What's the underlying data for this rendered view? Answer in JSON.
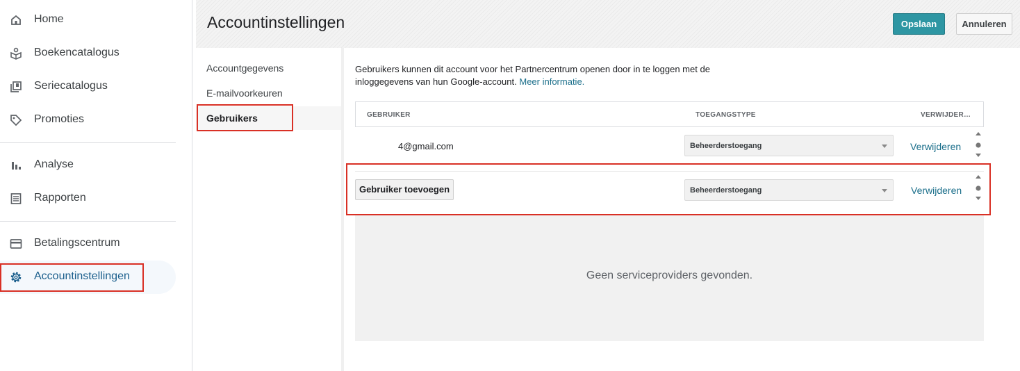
{
  "nav": {
    "items": [
      {
        "label": "Home",
        "icon": "home-icon"
      },
      {
        "label": "Boekencatalogus",
        "icon": "book-catalog-icon"
      },
      {
        "label": "Seriecatalogus",
        "icon": "series-catalog-icon"
      },
      {
        "label": "Promoties",
        "icon": "tag-icon"
      },
      {
        "label": "Analyse",
        "icon": "bar-chart-icon"
      },
      {
        "label": "Rapporten",
        "icon": "report-icon"
      },
      {
        "label": "Betalingscentrum",
        "icon": "credit-card-icon"
      },
      {
        "label": "Accountinstellingen",
        "icon": "gear-icon",
        "active": true
      }
    ]
  },
  "header": {
    "title": "Accountinstellingen",
    "save_label": "Opslaan",
    "cancel_label": "Annuleren"
  },
  "subnav": {
    "items": [
      {
        "label": "Accountgegevens"
      },
      {
        "label": "E-mailvoorkeuren"
      },
      {
        "label": "Gebruikers",
        "active": true
      }
    ]
  },
  "users": {
    "intro_text": "Gebruikers kunnen dit account voor het Partnercentrum openen door in te loggen met de inloggegevens van hun Google-account.",
    "more_info_link": "Meer informatie.",
    "columns": {
      "user": "GEBRUIKER",
      "access_type": "TOEGANGSTYPE",
      "remove": "VERWIJDER…"
    },
    "rows": [
      {
        "email": "4@gmail.com",
        "access": "Beheerderstoegang",
        "remove_label": "Verwijderen"
      }
    ],
    "new_row": {
      "add_button_label": "Gebruiker toevoegen",
      "access": "Beheerderstoegang",
      "remove_label": "Verwijderen"
    },
    "empty_message": "Geen serviceproviders gevonden."
  },
  "colors": {
    "primary_button": "#2e96a3",
    "link": "#1a6e8a",
    "active_nav_text": "#1a5e8c",
    "highlight_box": "#d93025"
  }
}
